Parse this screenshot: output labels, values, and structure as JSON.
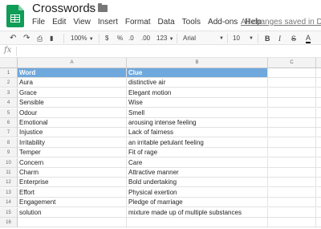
{
  "app": {
    "title": "Crosswords",
    "star_icon": "star-outline-icon",
    "folder_icon": "folder-icon",
    "save_status": "All changes saved in Drive"
  },
  "menu": [
    "File",
    "Edit",
    "View",
    "Insert",
    "Format",
    "Data",
    "Tools",
    "Add-ons",
    "Help"
  ],
  "toolbar": {
    "undo": "↶",
    "redo": "↷",
    "print": "⎙",
    "paint_format": "🖌",
    "zoom": "100%",
    "currency": "$",
    "percent": "%",
    "decrease_decimals": ".0",
    "increase_decimals": ".00",
    "more_formats": "123",
    "font": "Arial",
    "font_size": "10",
    "bold": "B",
    "italic": "I",
    "strikethrough": "S",
    "text_color": "A"
  },
  "formula_bar": {
    "fx_label": "fx",
    "value": ""
  },
  "columns": [
    "A",
    "B",
    "C"
  ],
  "header_color": "#6fa8dc",
  "rows": [
    {
      "num": "1",
      "word": "Word",
      "clue": "Clue"
    },
    {
      "num": "2",
      "word": "Aura",
      "clue": "distinctive air"
    },
    {
      "num": "3",
      "word": "Grace",
      "clue": "Elegant motion"
    },
    {
      "num": "4",
      "word": "Sensible",
      "clue": "Wise"
    },
    {
      "num": "5",
      "word": "Odour",
      "clue": "Smell"
    },
    {
      "num": "6",
      "word": "Emotional",
      "clue": "arousing intense feeling"
    },
    {
      "num": "7",
      "word": "Injustice",
      "clue": "Lack of fairness"
    },
    {
      "num": "8",
      "word": "Irritability",
      "clue": "an irritable petulant feeling"
    },
    {
      "num": "9",
      "word": "Temper",
      "clue": "Fit of rage"
    },
    {
      "num": "10",
      "word": "Concern",
      "clue": "Care"
    },
    {
      "num": "11",
      "word": "Charm",
      "clue": "Attractive manner"
    },
    {
      "num": "12",
      "word": "Enterprise",
      "clue": "Bold undertaking"
    },
    {
      "num": "13",
      "word": "Effort",
      "clue": "Physical exertion"
    },
    {
      "num": "14",
      "word": "Engagement",
      "clue": "Pledge of marriage"
    },
    {
      "num": "15",
      "word": "solution",
      "clue": "mixture made up of multiple substances"
    },
    {
      "num": "16",
      "word": "",
      "clue": ""
    }
  ]
}
